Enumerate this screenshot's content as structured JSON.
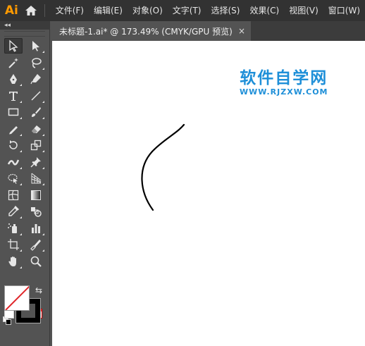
{
  "app": {
    "logo_text": "Ai"
  },
  "menu": [
    {
      "label": "文件(F)"
    },
    {
      "label": "编辑(E)"
    },
    {
      "label": "对象(O)"
    },
    {
      "label": "文字(T)"
    },
    {
      "label": "选择(S)"
    },
    {
      "label": "效果(C)"
    },
    {
      "label": "视图(V)"
    },
    {
      "label": "窗口(W)"
    }
  ],
  "tools_panel": {
    "collapse_label": "◂◂"
  },
  "document": {
    "tab_title": "未标题-1.ai* @ 173.49% (CMYK/GPU 预览)",
    "close_glyph": "×"
  },
  "watermark": {
    "title": "软件自学网",
    "url": "WWW.RJZXW.COM"
  },
  "colors": {
    "fill": "#ffffff",
    "stroke": "#000000",
    "none_slash": "#e0262a",
    "watermark": "#1e8fd8"
  },
  "tools": [
    [
      "selection-tool",
      "direct-selection-tool"
    ],
    [
      "magic-wand-tool",
      "lasso-tool"
    ],
    [
      "pen-tool",
      "curvature-tool"
    ],
    [
      "type-tool",
      "line-segment-tool"
    ],
    [
      "rectangle-tool",
      "paintbrush-tool"
    ],
    [
      "shaper-tool",
      "eraser-tool"
    ],
    [
      "rotate-tool",
      "scale-tool"
    ],
    [
      "width-tool",
      "puppet-warp-tool"
    ],
    [
      "shape-builder-tool",
      "perspective-grid-tool"
    ],
    [
      "mesh-tool",
      "gradient-tool"
    ],
    [
      "eyedropper-tool",
      "blend-tool"
    ],
    [
      "symbol-sprayer-tool",
      "column-graph-tool"
    ],
    [
      "artboard-tool",
      "slice-tool"
    ],
    [
      "hand-tool",
      "zoom-tool"
    ]
  ]
}
